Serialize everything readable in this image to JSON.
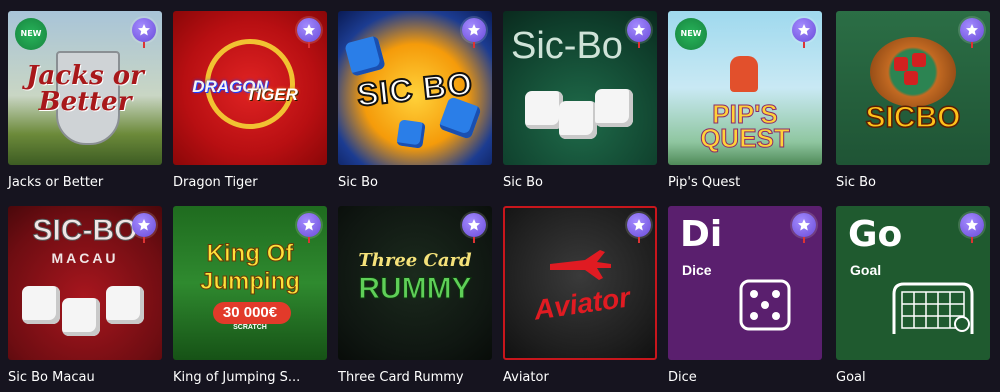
{
  "games": [
    {
      "title": "Jacks or Better",
      "art": "Jacks or Better",
      "new_label": "NEW"
    },
    {
      "title": "Dragon Tiger",
      "art_top": "DRAGON",
      "art_bottom": "TIGER"
    },
    {
      "title": "Sic Bo",
      "art": "SIC BO"
    },
    {
      "title": "Sic Bo",
      "art": "Sic-Bo"
    },
    {
      "title": "Pip's Quest",
      "art_top": "PIP'S",
      "art_bottom": "QUEST",
      "new_label": "NEW"
    },
    {
      "title": "Sic Bo",
      "art": "SICBO"
    },
    {
      "title": "Sic Bo Macau",
      "art_top": "SIC-BO",
      "art_bottom": "MACAU"
    },
    {
      "title": "King of Jumping S...",
      "art_top": "King Of",
      "art_bottom": "Jumping",
      "prize": "30 000€",
      "prize_sub": "SCRATCH"
    },
    {
      "title": "Three Card Rummy",
      "art_top": "Three Card",
      "art_bottom": "RUMMY"
    },
    {
      "title": "Aviator",
      "art": "Aviator"
    },
    {
      "title": "Dice",
      "symbol": "Di",
      "name": "Dice"
    },
    {
      "title": "Goal",
      "symbol": "Go",
      "name": "Goal"
    }
  ],
  "icons": {
    "favorite": "star-icon",
    "badge_color": "#7b5cf0",
    "new_color": "#1fa34d"
  }
}
